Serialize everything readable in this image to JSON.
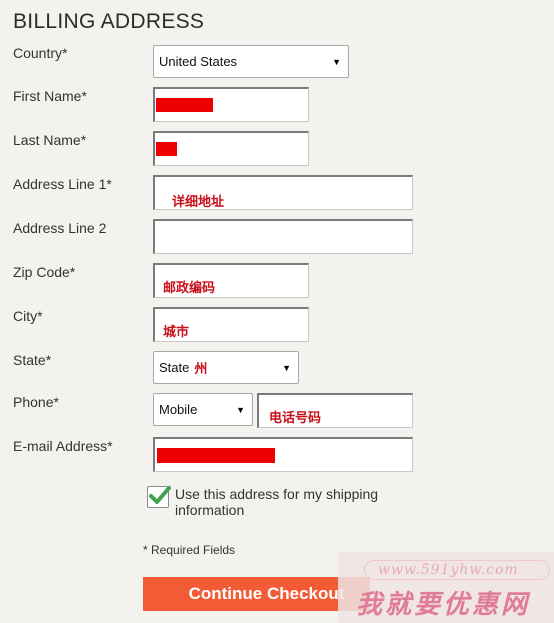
{
  "title": "BILLING ADDRESS",
  "fields": {
    "country": {
      "label": "Country*",
      "value": "United States"
    },
    "first_name": {
      "label": "First Name*"
    },
    "last_name": {
      "label": "Last Name*"
    },
    "address1": {
      "label": "Address Line 1*",
      "value": "详细地址"
    },
    "address2": {
      "label": "Address Line 2",
      "value": ""
    },
    "zip": {
      "label": "Zip Code*",
      "value": "邮政编码"
    },
    "city": {
      "label": "City*",
      "value": "城市"
    },
    "state": {
      "label": "State*",
      "value": "State",
      "annotation": "州"
    },
    "phone": {
      "label": "Phone*",
      "type_value": "Mobile",
      "value": "电话号码"
    },
    "email": {
      "label": "E-mail Address*"
    }
  },
  "shipping_checkbox": {
    "checked": true,
    "label": "Use this address for my shipping information"
  },
  "required_note": "* Required Fields",
  "continue_button": "Continue Checkout",
  "watermark": {
    "url": "www.591yhw.com",
    "text": "我就要优惠网"
  }
}
